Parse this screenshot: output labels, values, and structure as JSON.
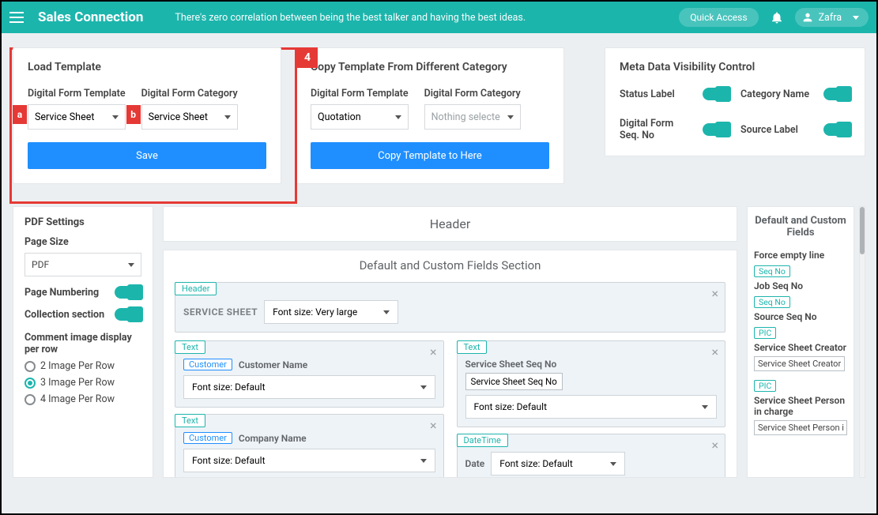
{
  "topbar": {
    "brand": "Sales Connection",
    "quote": "There's zero correlation between being the best talker and having the best ideas.",
    "quick": "Quick Access",
    "user": "Zafra"
  },
  "callouts": {
    "main": "4",
    "a": "a",
    "b": "b"
  },
  "card1": {
    "title": "Load Template",
    "tpl_label": "Digital Form Template",
    "cat_label": "Digital Form Category",
    "tpl_value": "Service Sheet",
    "cat_value": "Service Sheet",
    "save": "Save"
  },
  "card2": {
    "title": "Copy Template From Different Category",
    "tpl_label": "Digital Form Template",
    "cat_label": "Digital Form Category",
    "tpl_value": "Quotation",
    "cat_value": "Nothing selecte",
    "copy": "Copy Template to Here"
  },
  "card3": {
    "title": "Meta Data Visibility Control",
    "status": "Status Label",
    "category": "Category Name",
    "seq": "Digital Form Seq. No",
    "source": "Source Label"
  },
  "sidebar": {
    "title": "PDF Settings",
    "page_size": "Page Size",
    "page_size_value": "PDF",
    "page_numbering": "Page Numbering",
    "collection": "Collection section",
    "comment_img": "Comment image display per row",
    "r1": "2 Image Per Row",
    "r2": "3 Image Per Row",
    "r3": "4 Image Per Row"
  },
  "center": {
    "header": "Header",
    "section": "Default and Custom Fields Section",
    "hdr_tag": "Header",
    "service_sheet": "SERVICE SHEET",
    "font_vl": "Font size: Very large",
    "text_tag": "Text",
    "customer_tag": "Customer",
    "cust_name": "Customer Name",
    "font_def": "Font size: Default",
    "company": "Company Name",
    "seq_lbl": "Service Sheet Seq No",
    "seq_box": "Service Sheet Seq No",
    "datetime_tag": "DateTime",
    "date_lbl": "Date"
  },
  "rpanel": {
    "title": "Default and Custom Fields",
    "force": "Force empty line",
    "seqno": "Seq No",
    "job_seq": "Job Seq No",
    "source_seq": "Source Seq No",
    "pic": "PIC",
    "creator_lbl": "Service Sheet Creator",
    "creator_box": "Service Sheet Creator",
    "person_lbl": "Service Sheet Person in charge",
    "person_box": "Service Sheet Person i"
  }
}
